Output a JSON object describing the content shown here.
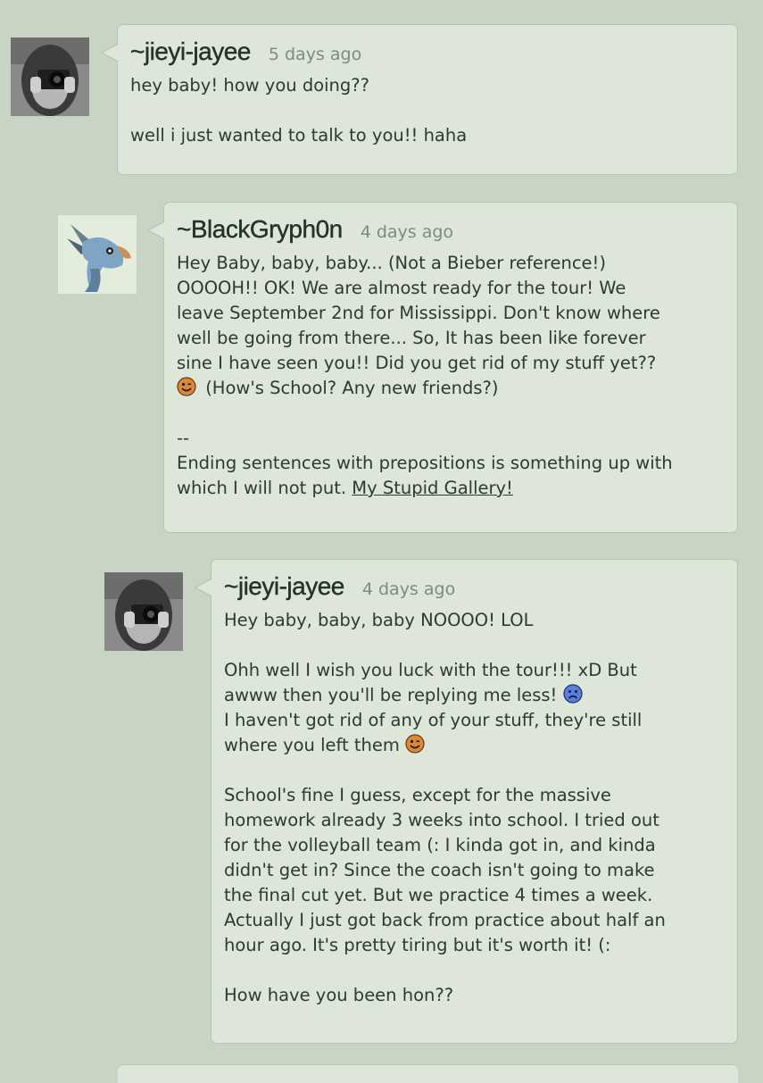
{
  "comments": [
    {
      "username": "~jieyi-jayee",
      "time": "5 days ago",
      "lines": [
        "hey baby! how you doing??",
        "",
        "well i just wanted to talk to you!! haha"
      ]
    },
    {
      "username": "~BlackGryph0n",
      "time": "4 days ago",
      "text_lines": [
        "Hey Baby, baby, baby... (Not a Bieber reference!)",
        "OOOOH!! OK! We are almost ready for the tour! We",
        "leave September 2nd for Mississippi. Don't know where",
        "well be going from there... So, It has been like forever",
        "sine I have seen you!! Did you get rid of my stuff yet??"
      ],
      "smiley_line": "(How's School? Any new friends?)",
      "sig_dash": "--",
      "sig_line1": "Ending sentences with prepositions is something up with",
      "sig_line2": "which I will not put.",
      "sig_link": "My Stupid Gallery!"
    },
    {
      "username": "~jieyi-jayee",
      "time": "4 days ago",
      "p1": "Hey baby, baby, baby NOOOO! LOL",
      "p2_line1": "Ohh well I wish you luck with the tour!!! xD But",
      "p2_line2": "awww then you'll be replying me less!",
      "p2_line3": "I haven't got rid of any of your stuff, they're still",
      "p2_line4": "where you left them",
      "p3_lines": [
        "School's fine I guess, except for the massive",
        "homework already 3 weeks into school. I tried out",
        "for the volleyball team (: I kinda got in, and kinda",
        "didn't get in? Since the coach isn't going to make",
        "the final cut yet. But we practice 4 times a week.",
        "Actually I just got back from practice about half an",
        "hour ago. It's pretty tiring but it's worth it! (:"
      ],
      "p4": "How have you been hon??"
    }
  ],
  "smileys": {
    "grin": "wink-smiley-icon",
    "sad": "sad-smiley-icon"
  },
  "colors": {
    "background": "#c9d5c4",
    "bubble": "#dde6d8",
    "border": "#b6c4b1",
    "username": "#23342a",
    "time": "#7e8c7f"
  }
}
